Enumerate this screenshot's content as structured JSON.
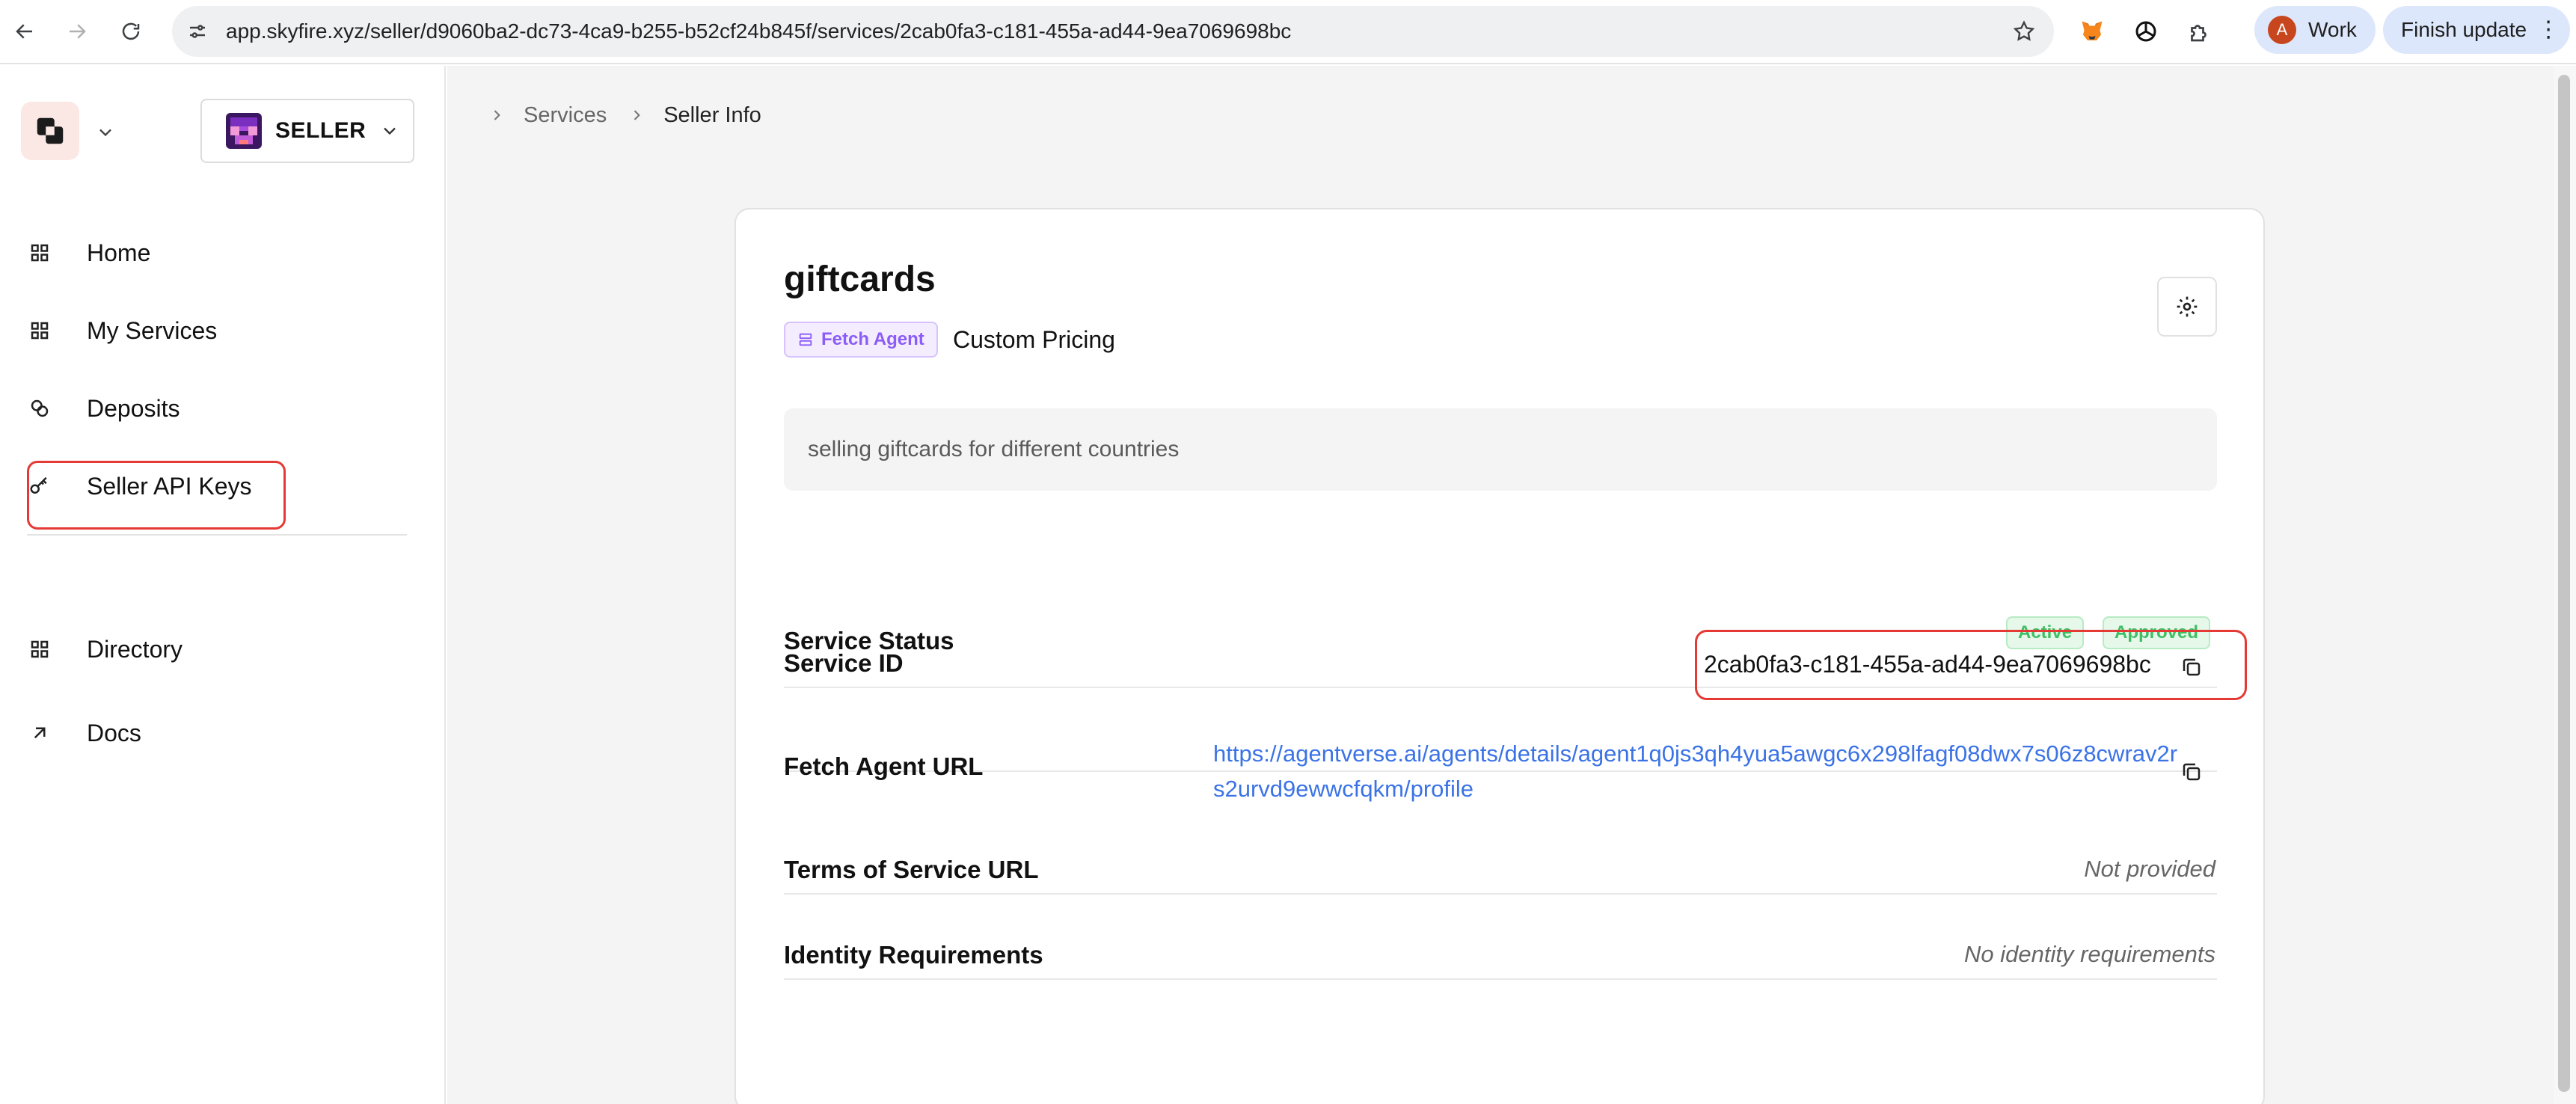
{
  "browser": {
    "url": "app.skyfire.xyz/seller/d9060ba2-dc73-4ca9-b255-b52cf24b845f/services/2cab0fa3-c181-455a-ad44-9ea7069698bc",
    "profile_initial": "A",
    "profile_name": "Work",
    "finish_update_label": "Finish update",
    "extensions": [
      "metamask-fox-icon",
      "openai-icon",
      "puzzle-extensions-icon"
    ]
  },
  "sidebar": {
    "role_label": "SELLER",
    "items": [
      {
        "label": "Home",
        "icon": "grid-icon"
      },
      {
        "label": "My Services",
        "icon": "grid-icon"
      },
      {
        "label": "Deposits",
        "icon": "coins-icon"
      },
      {
        "label": "Seller API Keys",
        "icon": "key-icon"
      },
      {
        "label": "Directory",
        "icon": "grid-icon"
      },
      {
        "label": "Docs",
        "icon": "arrow-up-right-icon"
      }
    ]
  },
  "breadcrumb": {
    "items": [
      "Services",
      "Seller Info"
    ]
  },
  "service": {
    "name": "giftcards",
    "agent_badge": "Fetch Agent",
    "pricing": "Custom Pricing",
    "description": "selling giftcards for different countries",
    "rows": {
      "status_label": "Service Status",
      "status_badges": [
        "Active",
        "Approved"
      ],
      "id_label": "Service ID",
      "id_value": "2cab0fa3-c181-455a-ad44-9ea7069698bc",
      "fetch_url_label": "Fetch Agent URL",
      "fetch_url_value": "https://agentverse.ai/agents/details/agent1q0js3qh4yua5awgc6x298lfagf08dwx7s06z8cwrav2rs2urvd9ewwcfqkm/profile",
      "tos_label": "Terms of Service URL",
      "tos_value": "Not provided",
      "identity_label": "Identity Requirements",
      "identity_value": "No identity requirements"
    }
  },
  "colors": {
    "accent_link": "#3b73e6",
    "badge_green": "#3fbf64",
    "badge_purple": "#8b5cf6",
    "highlight_red": "#e53935"
  }
}
